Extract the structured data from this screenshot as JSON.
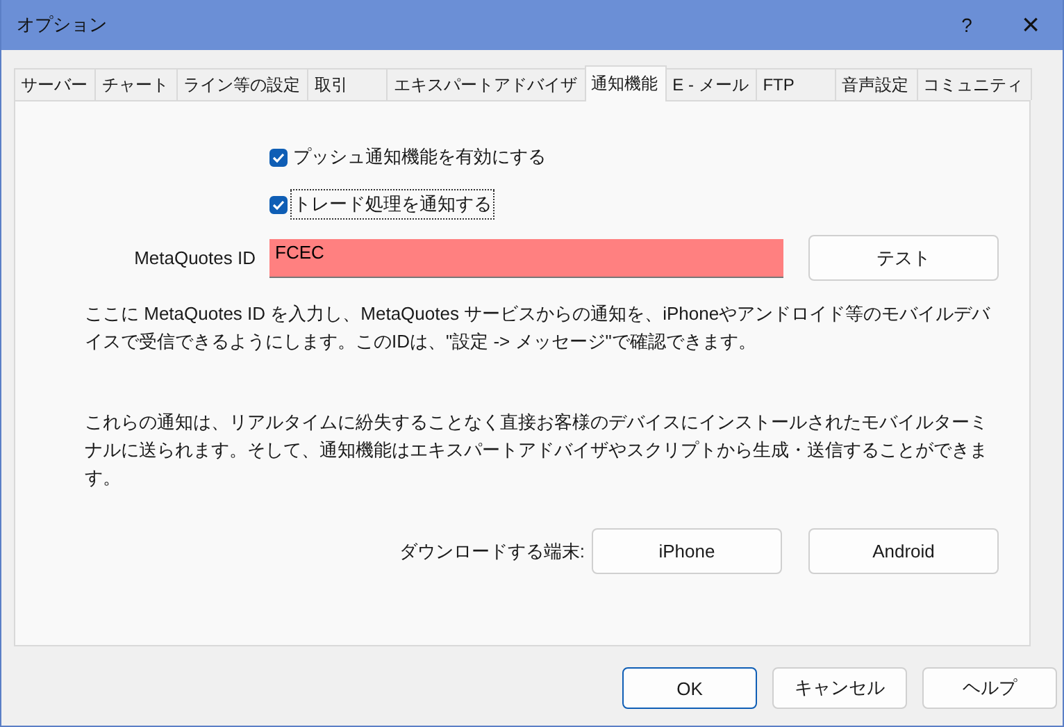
{
  "window": {
    "title": "オプション",
    "help": "?",
    "close": "×"
  },
  "tabs": [
    {
      "label": "サーバー",
      "selected": false
    },
    {
      "label": "チャート",
      "selected": false
    },
    {
      "label": "ライン等の設定",
      "selected": false
    },
    {
      "label": "取引",
      "selected": false
    },
    {
      "label": "エキスパートアドバイザ",
      "selected": false
    },
    {
      "label": "通知機能",
      "selected": true
    },
    {
      "label": "E - メール",
      "selected": false
    },
    {
      "label": "FTP",
      "selected": false
    },
    {
      "label": "音声設定",
      "selected": false
    },
    {
      "label": "コミュニティ",
      "selected": false
    }
  ],
  "checkboxes": [
    {
      "label": "プッシュ通知機能を有効にする",
      "checked": true,
      "focused": false
    },
    {
      "label": "トレード処理を通知する",
      "checked": true,
      "focused": true
    }
  ],
  "id_field": {
    "label": "MetaQuotes ID",
    "value": "FCEC",
    "invalid": true,
    "button": "テスト"
  },
  "paragraphs": [
    "ここに MetaQuotes ID を入力し、MetaQuotes サービスからの通知を、iPhoneやアンドロイド等のモバイルデバイスで受信できるようにします。このIDは、\"設定 -> メッセージ\"で確認できます。",
    "これらの通知は、リアルタイムに紛失することなく直接お客様のデバイスにインストールされたモバイルターミナルに送られます。そして、通知機能はエキスパートアドバイザやスクリプトから生成・送信することができます。"
  ],
  "download": {
    "label": "ダウンロードする端末:",
    "buttons": [
      "iPhone",
      "Android"
    ]
  },
  "footer_buttons": [
    {
      "label": "OK",
      "default": true
    },
    {
      "label": "キャンセル",
      "default": false
    },
    {
      "label": "ヘルプ",
      "default": false
    }
  ]
}
